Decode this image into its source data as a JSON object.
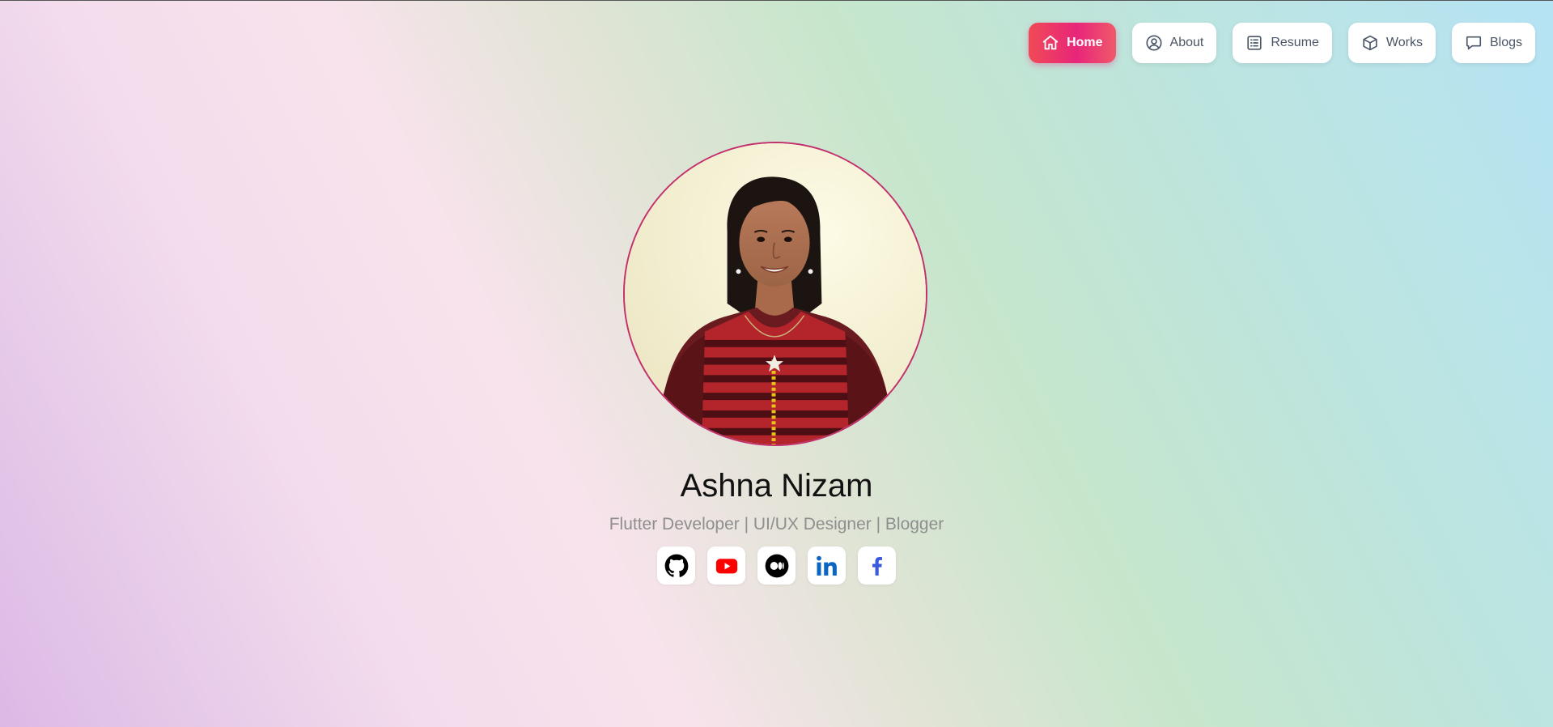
{
  "nav": {
    "items": [
      {
        "label": "Home",
        "icon": "home-icon",
        "active": true
      },
      {
        "label": "About",
        "icon": "user-circle-icon",
        "active": false
      },
      {
        "label": "Resume",
        "icon": "document-list-icon",
        "active": false
      },
      {
        "label": "Works",
        "icon": "cube-icon",
        "active": false
      },
      {
        "label": "Blogs",
        "icon": "chat-bubble-icon",
        "active": false
      }
    ]
  },
  "profile": {
    "name": "Ashna Nizam",
    "tagline": "Flutter Developer | UI/UX Designer | Blogger"
  },
  "socials": [
    {
      "icon": "github-icon",
      "color": "#000000"
    },
    {
      "icon": "youtube-icon",
      "color": "#ff0000"
    },
    {
      "icon": "medium-icon",
      "color": "#000000"
    },
    {
      "icon": "linkedin-icon",
      "color": "#0a66c2"
    },
    {
      "icon": "facebook-icon",
      "color": "#3b5bdb"
    }
  ],
  "colors": {
    "accent_gradient_start": "#f04a56",
    "accent_gradient_end": "#e8257a",
    "avatar_border": "#c2306e",
    "name_text": "#111111",
    "tagline_text": "#8e8e8e"
  }
}
